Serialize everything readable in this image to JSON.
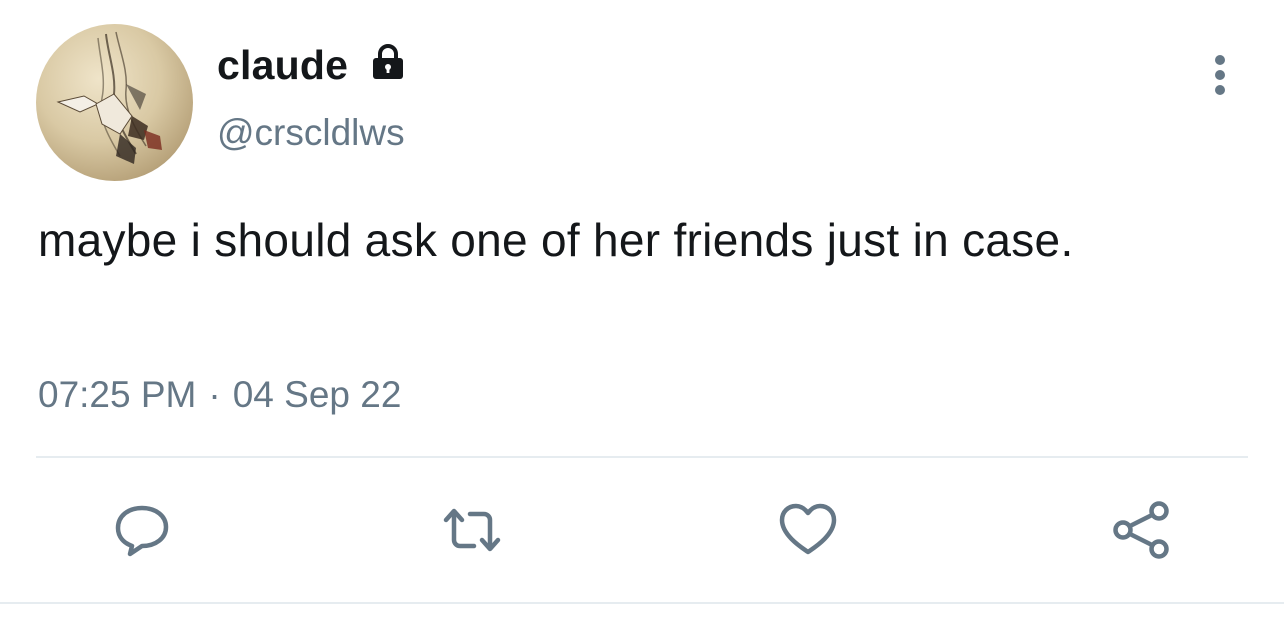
{
  "user": {
    "display_name": "claude",
    "handle": "@crscldlws",
    "protected_icon": "lock-icon",
    "avatar": "avatar-illustration"
  },
  "tweet": {
    "text": "maybe i should ask one of her friends just in case.",
    "time": "07:25 PM",
    "separator": "·",
    "date": "04 Sep 22"
  },
  "menu": {
    "icon": "more-vertical-icon"
  },
  "actions": [
    {
      "name": "reply",
      "icon": "reply-icon"
    },
    {
      "name": "retweet",
      "icon": "retweet-icon"
    },
    {
      "name": "like",
      "icon": "heart-icon"
    },
    {
      "name": "share",
      "icon": "share-icon"
    }
  ],
  "colors": {
    "text_primary": "#14171a",
    "text_secondary": "#657786",
    "divider": "#e6ecf0"
  }
}
